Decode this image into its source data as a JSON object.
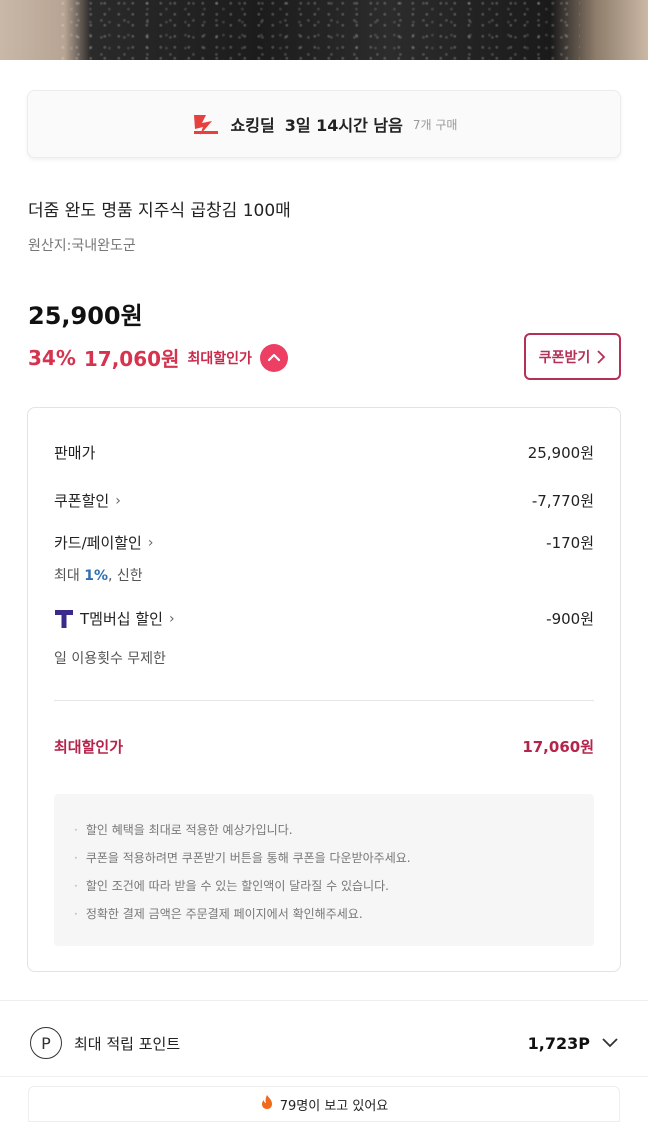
{
  "shocking_deal": {
    "label": "쇼킹딜",
    "remaining": "3일 14시간 남음",
    "purchased": "7개 구매"
  },
  "product": {
    "title": "더줌 완도 명품 지주식 곱창김 100매",
    "origin": "원산지:국내완도군",
    "original_price": "25,900원",
    "discount_rate": "34%",
    "discount_price": "17,060원",
    "max_discount_label": "최대할인가"
  },
  "coupon_button": {
    "label": "쿠폰받기"
  },
  "breakdown": {
    "sale_price_label": "판매가",
    "sale_price": "25,900원",
    "coupon_label": "쿠폰할인",
    "coupon_value": "-7,770원",
    "card_label": "카드/페이할인",
    "card_value": "-170원",
    "card_sub_prefix": "최대 ",
    "card_sub_pct": "1%",
    "card_sub_suffix": ", 신한",
    "tmembership_label": "T멤버십 할인",
    "tmembership_value": "-900원",
    "tmembership_sub": "일 이용횟수 무제한",
    "max_label": "최대할인가",
    "max_value": "17,060원"
  },
  "notices": [
    "할인 혜택을 최대로 적용한 예상가입니다.",
    "쿠폰을 적용하려면 쿠폰받기 버튼을 통해 쿠폰을 다운받아주세요.",
    "할인 조건에 따라 받을 수 있는 할인액이 달라질 수 있습니다.",
    "정확한 결제 금액은 주문결제 페이지에서 확인해주세요."
  ],
  "points": {
    "icon_letter": "P",
    "label": "최대 적립 포인트",
    "value": "1,723P"
  },
  "viewers": {
    "text": "79명이 보고 있어요"
  },
  "colors": {
    "accent": "#d6334f",
    "coupon_border": "#b43055",
    "link_blue": "#2f6fb3",
    "t_purple": "#3a2a8c"
  }
}
